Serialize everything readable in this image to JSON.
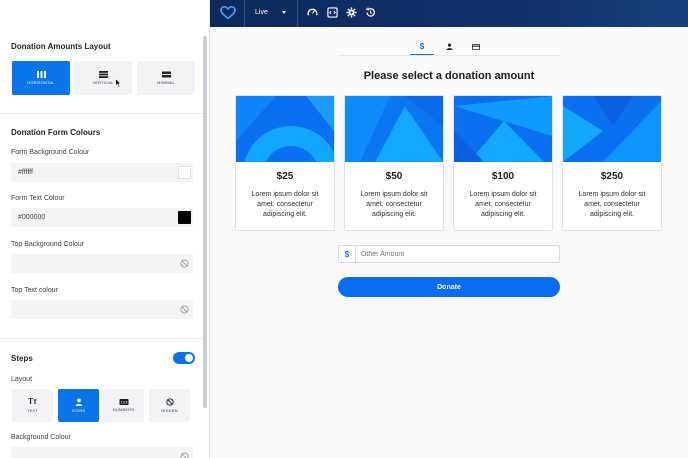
{
  "left_panel": {
    "amounts_layout": {
      "title": "Donation Amounts Layout",
      "options": [
        {
          "label": "HORIZONTAL",
          "active": true
        },
        {
          "label": "VERTICAL",
          "active": false
        },
        {
          "label": "MINIMAL",
          "active": false
        }
      ]
    },
    "form_colours": {
      "title": "Donation Form Colours",
      "form_background": {
        "label": "Form Background Colour",
        "value": "#ffffff",
        "swatch": "#ffffff"
      },
      "form_text": {
        "label": "Form Text Colour",
        "value": "#000000",
        "swatch": "#000000"
      },
      "top_background": {
        "label": "Top Background Colour",
        "value": ""
      },
      "top_text": {
        "label": "Top Text colour",
        "value": ""
      }
    },
    "steps": {
      "title": "Steps",
      "enabled": true,
      "layout_label": "Layout",
      "layout_options": [
        {
          "label": "TEXT",
          "icon": "text-icon",
          "active": false
        },
        {
          "label": "ICONS",
          "icon": "person-icon",
          "active": true
        },
        {
          "label": "NUMBERS",
          "icon": "numbers-icon",
          "active": false
        },
        {
          "label": "HIDDEN",
          "icon": "hidden-icon",
          "active": false
        }
      ],
      "background_colour_label": "Background Colour"
    }
  },
  "topbar": {
    "logo": "heart-logo",
    "status": "Live",
    "icons": [
      "gauge-icon",
      "embed-icon",
      "gear-icon",
      "history-icon"
    ]
  },
  "form": {
    "step_tabs": [
      {
        "icon": "dollar-icon",
        "label": "$",
        "active": true
      },
      {
        "icon": "person-icon",
        "active": false
      },
      {
        "icon": "card-icon",
        "active": false
      }
    ],
    "heading": "Please select a donation amount",
    "cards": [
      {
        "amount": "$25",
        "description": "Lorem ipsum dolor sit amet, consectetur adipiscing elit."
      },
      {
        "amount": "$50",
        "description": "Lorem ipsum dolor sit amet, consectetur adipiscing elit."
      },
      {
        "amount": "$100",
        "description": "Lorem ipsum dolor sit amet, consectetur adipiscing elit."
      },
      {
        "amount": "$250",
        "description": "Lorem ipsum dolor sit amet, consectetur adipiscing elit."
      }
    ],
    "other_amount": {
      "currency": "$",
      "placeholder": "Other Amount",
      "value": ""
    },
    "donate_label": "Donate"
  },
  "colors": {
    "accent": "#0a75e8",
    "topbar": "#0d2a5c",
    "card_image": "#0a7ef5"
  }
}
